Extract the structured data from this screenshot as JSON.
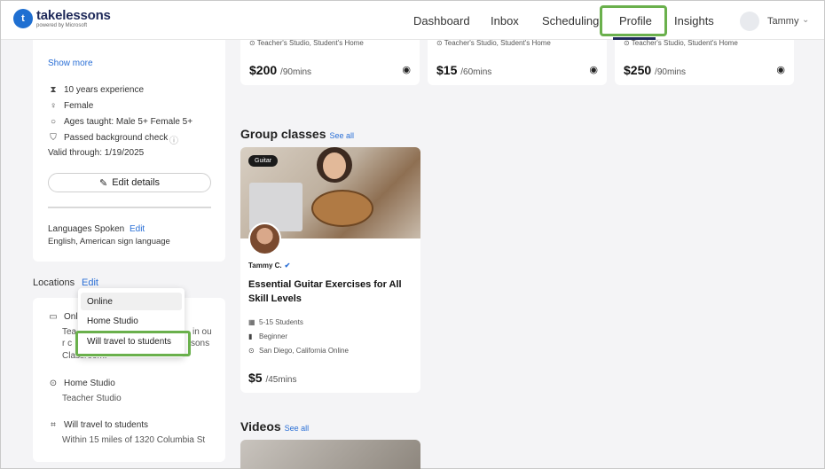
{
  "header": {
    "brand": "takelessons",
    "brand_sub": "powered by Microsoft",
    "nav": [
      "Dashboard",
      "Inbox",
      "Scheduling",
      "Profile",
      "Insights"
    ],
    "user_name": "Tammy"
  },
  "left_card": {
    "show_more": "Show more",
    "details": [
      {
        "icon": "hourglass-icon",
        "text": "10 years experience"
      },
      {
        "icon": "gender-icon",
        "text": "Female"
      },
      {
        "icon": "age-icon",
        "text": "Ages taught: Male 5+ Female 5+"
      },
      {
        "icon": "shield-icon",
        "text": "Passed background check"
      }
    ],
    "valid_through": "Valid through: 1/19/2025",
    "edit_details": "Edit details",
    "languages_label": "Languages Spoken",
    "languages_edit": "Edit",
    "languages_value": "English, American sign language"
  },
  "locations": {
    "label": "Locations",
    "edit": "Edit",
    "online_partial": "Onl",
    "online_desc_partial_1": "Tea",
    "online_desc_partial_2": "r c",
    "online_desc_tail_1": "in ou",
    "online_desc_tail_2": "sons",
    "online_desc_line3": "Classroom.",
    "home_studio_title": "Home Studio",
    "home_studio_value": "Teacher Studio",
    "travel_title": "Will travel to students",
    "travel_value": "Within 15 miles of 1320 Columbia St"
  },
  "dropdown": {
    "options": [
      "Online",
      "Home Studio",
      "Will travel to students"
    ],
    "selected": "Online"
  },
  "price_cards": [
    {
      "location": "Teacher's Studio, Student's Home",
      "price": "$200",
      "per": "/90mins"
    },
    {
      "location": "Teacher's Studio, Student's Home",
      "price": "$15",
      "per": "/60mins"
    },
    {
      "location": "Teacher's Studio, Student's Home",
      "price": "$250",
      "per": "/90mins"
    }
  ],
  "group_classes": {
    "title": "Group classes",
    "see_all": "See all",
    "card": {
      "tag": "Guitar",
      "teacher": "Tammy C.",
      "title": "Essential Guitar Exercises for All Skill Levels",
      "students": "5-15 Students",
      "level": "Beginner",
      "location": "San Diego, California Online",
      "price": "$5",
      "per": "/45mins"
    }
  },
  "videos": {
    "title": "Videos",
    "see_all": "See all"
  },
  "colors": {
    "highlight": "#6ab04c",
    "link": "#2a6fd6",
    "brand": "#1f6fd1"
  }
}
